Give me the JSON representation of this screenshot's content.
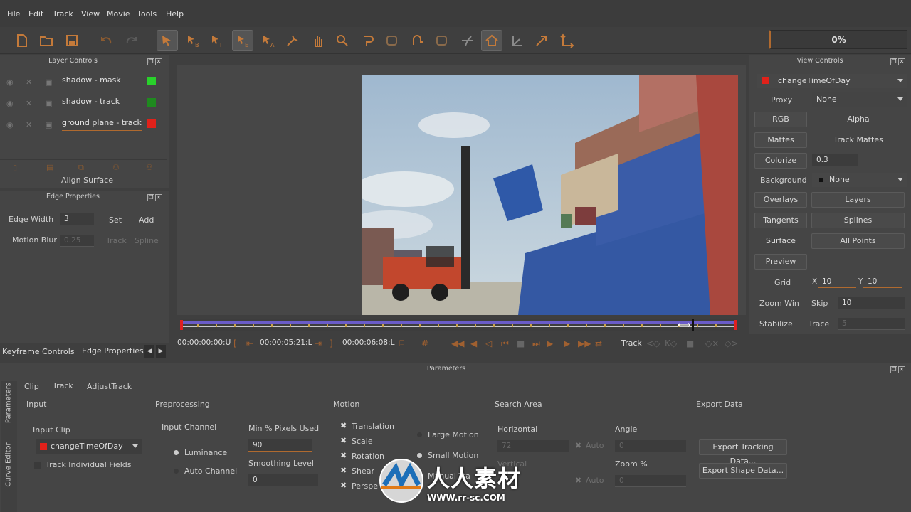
{
  "menu": [
    "File",
    "Edit",
    "Track",
    "View",
    "Movie",
    "Tools",
    "Help"
  ],
  "toolbar": {
    "progress": "0%",
    "icons": [
      "new-file-icon",
      "open-folder-icon",
      "save-icon",
      "undo-icon",
      "redo-icon",
      "select-arrow-icon",
      "select-b-icon",
      "select-i-icon",
      "select-e-icon",
      "select-a-icon",
      "move-point-icon",
      "hand-pan-icon",
      "zoom-icon",
      "shape-tool-icon",
      "shape-edit-icon",
      "xspline-icon",
      "bspline-icon",
      "tracker-icon",
      "surface-home-icon",
      "corner-pin-icon",
      "arrow-ne-icon",
      "axis-icon"
    ]
  },
  "layer_controls": {
    "title": "Layer Controls",
    "layers": [
      {
        "name": "shadow - mask",
        "color": "#29d12b"
      },
      {
        "name": "shadow - track",
        "color": "#1f8a1f"
      },
      {
        "name": "ground plane - track",
        "color": "#e0211a"
      }
    ],
    "align_surface": "Align Surface"
  },
  "edge_properties": {
    "title": "Edge Properties",
    "edge_width_label": "Edge Width",
    "edge_width": "3",
    "set": "Set",
    "add": "Add",
    "motion_blur_label": "Motion Blur",
    "motion_blur": "0.25",
    "track": "Track",
    "spline": "Spline"
  },
  "left_tabs": {
    "keyframe": "Keyframe Controls",
    "edge": "Edge Properties"
  },
  "transport": {
    "start_tc": "00:00:00:00:U",
    "current_tc": "00:00:05:21:L",
    "end_tc": "00:00:06:08:L",
    "track_label": "Track"
  },
  "view_controls": {
    "title": "View Controls",
    "clip": "changeTimeOfDay",
    "clip_color": "#e0211a",
    "proxy_label": "Proxy",
    "proxy_value": "None",
    "rgb": "RGB",
    "alpha": "Alpha",
    "mattes": "Mattes",
    "track_mattes": "Track Mattes",
    "colorize": "Colorize",
    "colorize_value": "0.3",
    "background_label": "Background",
    "background_value": "None",
    "overlays": "Overlays",
    "layers": "Layers",
    "tangents": "Tangents",
    "splines": "Splines",
    "surface": "Surface",
    "all_points": "All Points",
    "preview": "Preview",
    "grid_label": "Grid",
    "grid_x_label": "X",
    "grid_x": "10",
    "grid_y_label": "Y",
    "grid_y": "10",
    "zoom_win": "Zoom Win",
    "skip_label": "Skip",
    "skip_value": "10",
    "stabilize": "Stabilize",
    "trace_label": "Trace",
    "trace_value": "5"
  },
  "parameters": {
    "title": "Parameters",
    "side_tabs": [
      "Parameters",
      "Curve Editor"
    ],
    "tabs": [
      "Clip",
      "Track",
      "AdjustTrack"
    ],
    "input": {
      "header": "Input",
      "clip_label": "Input Clip",
      "clip_value": "changeTimeOfDay",
      "individual_fields": "Track Individual Fields"
    },
    "preprocessing": {
      "header": "Preprocessing",
      "channel_label": "Input Channel",
      "luminance": "Luminance",
      "auto_channel": "Auto Channel",
      "min_pixels_label": "Min % Pixels Used",
      "min_pixels": "90",
      "smoothing_label": "Smoothing Level",
      "smoothing": "0"
    },
    "motion": {
      "header": "Motion",
      "translation": "Translation",
      "scale": "Scale",
      "rotation": "Rotation",
      "shear": "Shear",
      "perspective": "Perspe",
      "large_motion": "Large Motion",
      "small_motion": "Small Motion",
      "manual_track": "Manual Tra"
    },
    "search_area": {
      "header": "Search Area",
      "horizontal_label": "Horizontal",
      "horizontal": "72",
      "vertical_label": "Vertical",
      "auto": "Auto",
      "angle_label": "Angle",
      "angle": "0",
      "zoom_label": "Zoom %",
      "zoom": "0"
    },
    "export": {
      "header": "Export Data",
      "tracking": "Export Tracking Data...",
      "shape": "Export Shape Data..."
    }
  },
  "watermark": {
    "cn": "人人素材",
    "url": "WWW.rr-sc.COM"
  }
}
